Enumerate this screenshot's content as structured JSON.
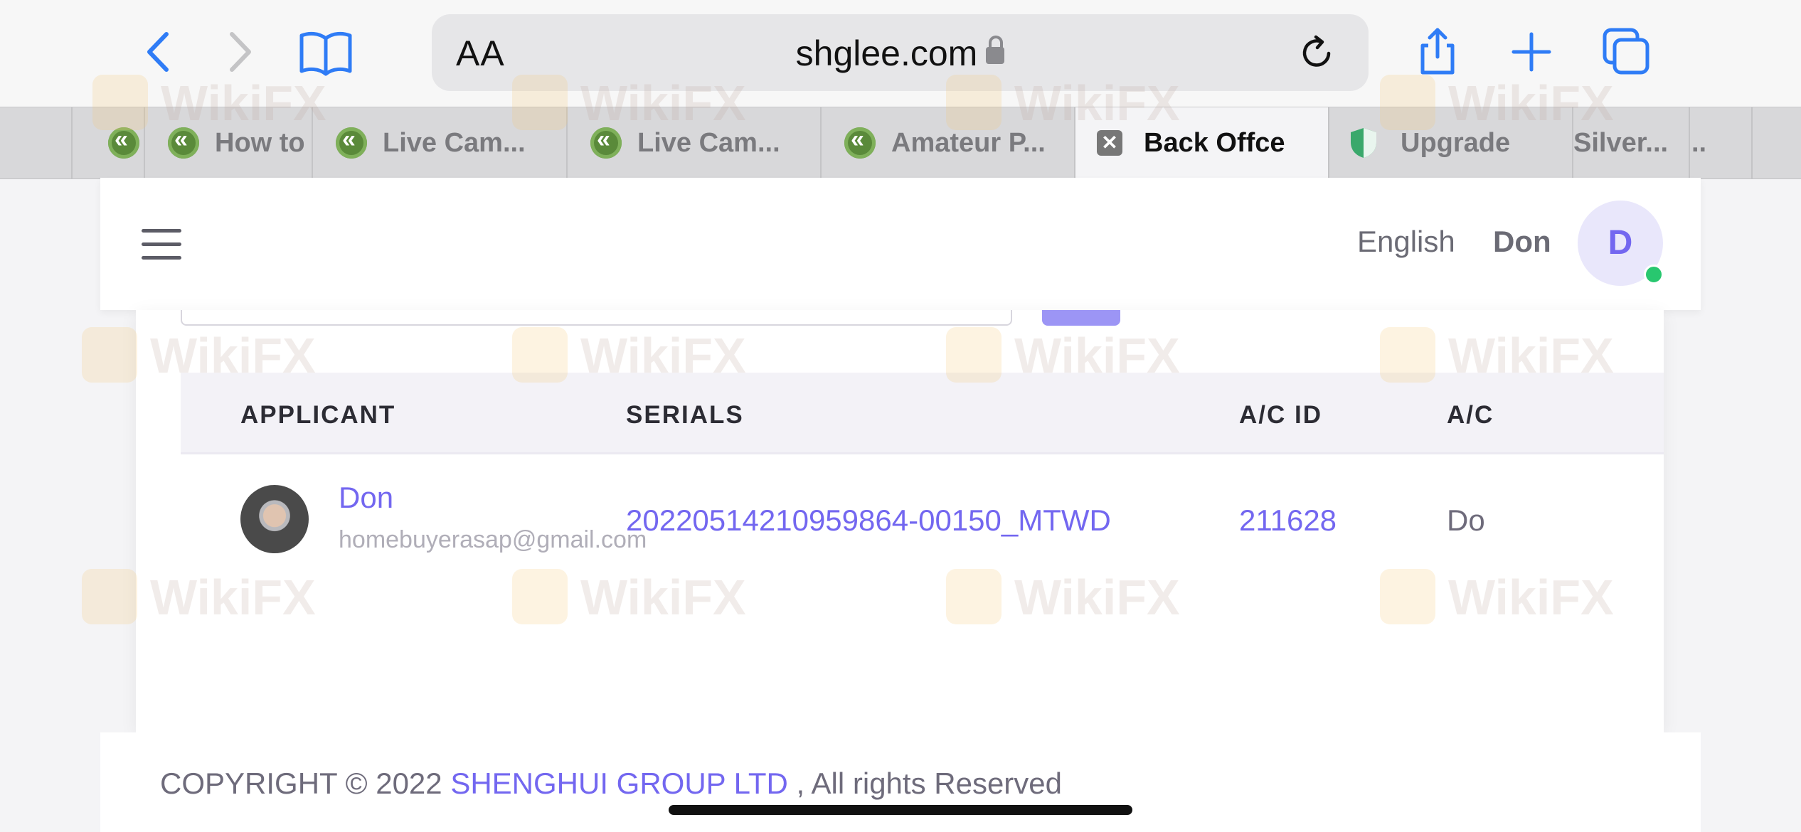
{
  "browser": {
    "address": {
      "text_size_label": "AA",
      "domain": "shglee.com"
    },
    "tabs": [
      {
        "label": "",
        "icon": "wikifx-favicon"
      },
      {
        "label": "How to",
        "icon": "wikifx-favicon"
      },
      {
        "label": "Live Cam...",
        "icon": "wikifx-favicon"
      },
      {
        "label": "Live Cam...",
        "icon": "wikifx-favicon"
      },
      {
        "label": "Amateur P...",
        "icon": "wikifx-favicon"
      },
      {
        "label": "Back Offce",
        "icon": "close-icon",
        "active": true
      },
      {
        "label": "Upgrade",
        "icon": "shield-favicon"
      },
      {
        "label": "Silver...",
        "icon": ""
      },
      {
        "label": "..",
        "icon": ""
      }
    ]
  },
  "header": {
    "language": "English",
    "user_name": "Don",
    "avatar_initial": "D"
  },
  "table": {
    "columns": [
      "APPLICANT",
      "SERIALS",
      "A/C ID",
      "A/C"
    ],
    "rows": [
      {
        "applicant_name": "Don",
        "applicant_email": "homebuyerasap@gmail.com",
        "serial": "20220514210959864-00150_MTWD",
        "ac_id": "211628",
        "ac_extra": "Do"
      }
    ]
  },
  "footer": {
    "copyright": "COPYRIGHT © 2022",
    "company": "SHENGHUI GROUP LTD",
    "rights": ", All rights Reserved"
  },
  "watermark": "WikiFX",
  "colors": {
    "accent": "#7367f0",
    "online": "#28c76f",
    "ios_blue": "#2f7cf6"
  }
}
